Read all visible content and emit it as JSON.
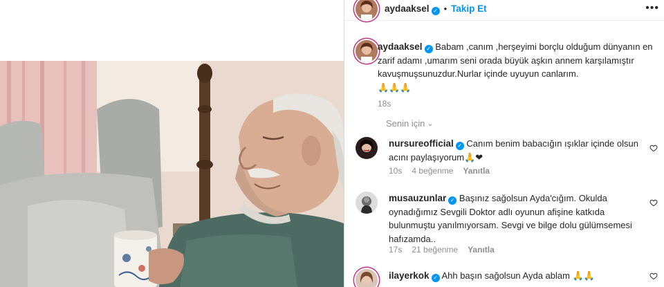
{
  "post": {
    "author": "aydaaksel",
    "follow_label": "Takip Et",
    "more_label": "•••",
    "caption": {
      "text": "Babam ,canım ,herşeyimi borçlu olduğum dünyanın en zarif adamı ,umarım seni orada büyük aşkın annem karşılamıştır kavuşmuşsunuzdur.Nurlar içinde uyuyun canlarım.",
      "emoji": "🙏🙏🙏",
      "time": "18s"
    },
    "for_you_label": "Senin için",
    "comments": [
      {
        "username": "nursureofficial",
        "text": "Canım benim babacığın ışıklar içinde olsun acını paylaşıyorum",
        "emoji": "🙏❤",
        "time": "10s",
        "likes": "4 beğenme",
        "reply": "Yanıtla"
      },
      {
        "username": "musauzunlar",
        "text": "Başınız sağolsun Ayda'cığım. Okulda oynadığımız Sevgili Doktor adlı oyunun afişine katkıda bulunmuştu yanılmıyorsam. Sevgi ve bilge dolu gülümsemesi hafızamda..",
        "emoji": "",
        "time": "17s",
        "likes": "21 beğenme",
        "reply": "Yanıtla"
      },
      {
        "username": "ilayerkok",
        "text": "Ahh başın sağolsun Ayda ablam",
        "emoji": "🙏🙏",
        "time": "",
        "likes": "",
        "reply": ""
      }
    ]
  },
  "colors": {
    "link_blue": "#0095f6",
    "muted": "#8e8e8e",
    "text": "#262626",
    "heart_red": "#ed4956"
  }
}
